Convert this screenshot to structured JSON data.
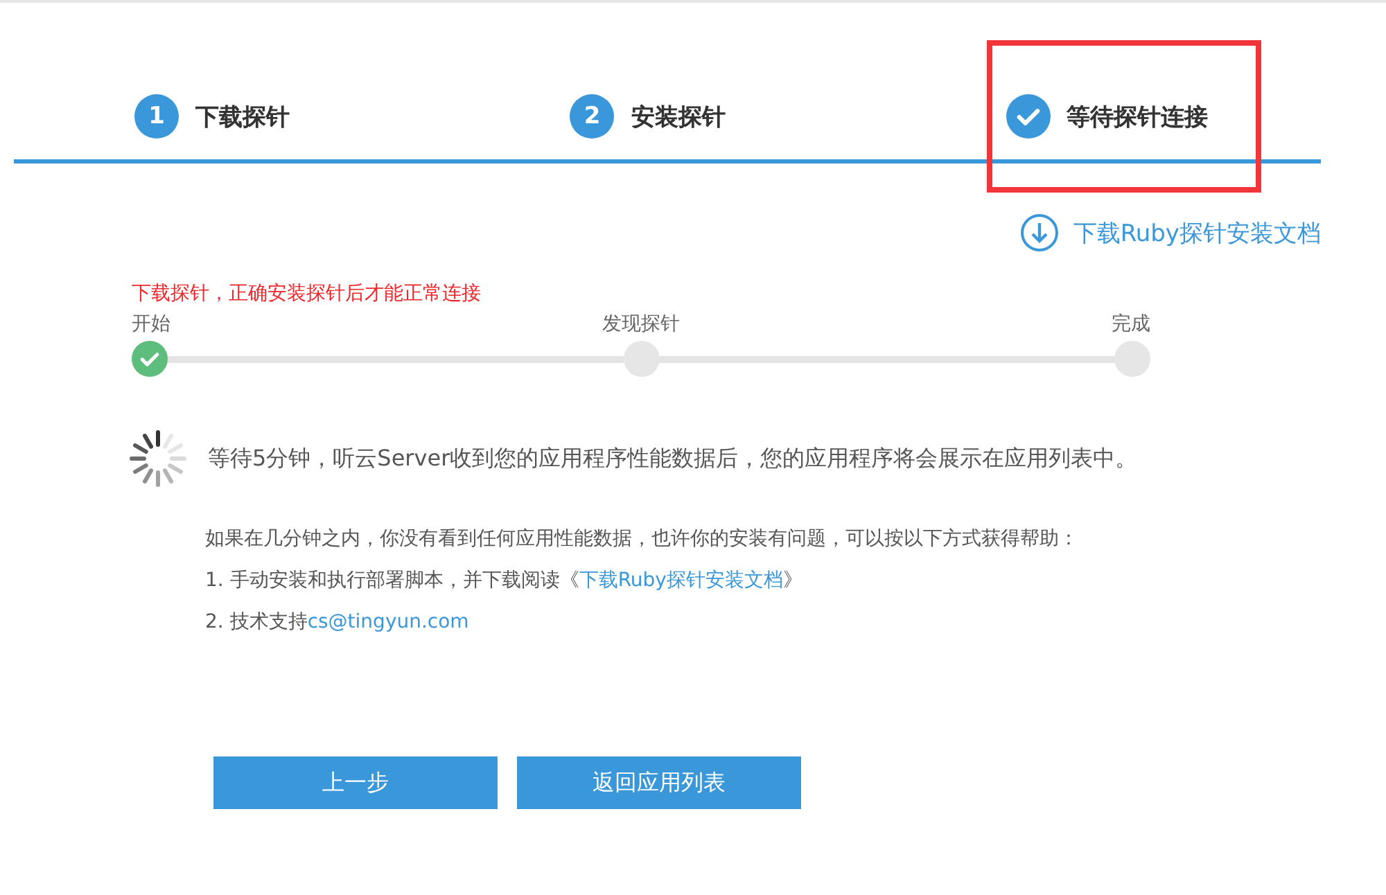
{
  "steps": [
    {
      "kind": "number",
      "badge": "1",
      "label": "下载探针",
      "highlighted": false
    },
    {
      "kind": "number",
      "badge": "2",
      "label": "安装探针",
      "highlighted": false
    },
    {
      "kind": "check",
      "label": "等待探针连接",
      "highlighted": true
    }
  ],
  "doc_link": "下载Ruby探针安装文档",
  "warning": "下载探针，正确安装探针后才能正常连接",
  "progress": [
    {
      "label": "开始",
      "done": true
    },
    {
      "label": "发现探针",
      "done": false
    },
    {
      "label": "完成",
      "done": false
    }
  ],
  "waiting_message": "等待5分钟，听云Server收到您的应用程序性能数据后，您的应用程序将会展示在应用列表中。",
  "help_intro": "如果在几分钟之内，你没有看到任何应用性能数据，也许你的安装有问题，可以按以下方式获得帮助：",
  "help_items": [
    {
      "text": "1. 手动安装和执行部署脚本，并下载阅读《",
      "link": "下载Ruby探针安装文档",
      "suffix": "》"
    },
    {
      "text": "2. 技术支持",
      "link": "cs@tingyun.com"
    }
  ],
  "buttons": [
    {
      "label": "上一步"
    },
    {
      "label": "返回应用列表"
    }
  ]
}
